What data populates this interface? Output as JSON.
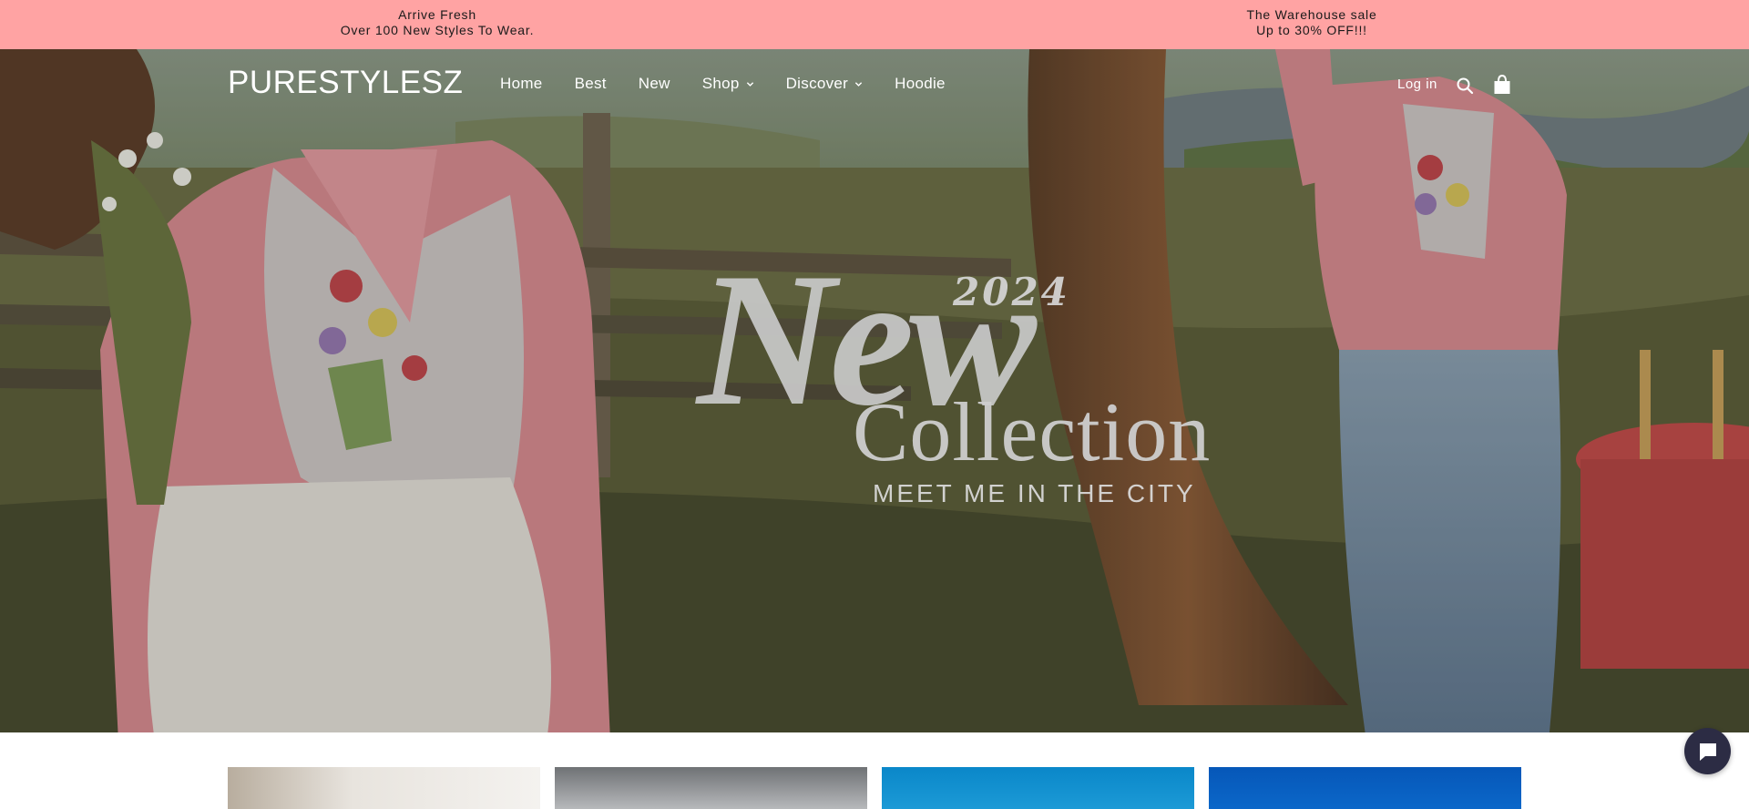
{
  "announcement": {
    "left": {
      "line1": "Arrive Fresh",
      "line2": "Over 100 New Styles To Wear."
    },
    "right": {
      "line1": "The Warehouse sale",
      "line2": "Up to 30% OFF!!!"
    },
    "background": "#ffa3a3"
  },
  "header": {
    "logo": "PURESTYLESZ",
    "nav": [
      {
        "label": "Home",
        "has_dropdown": false
      },
      {
        "label": "Best",
        "has_dropdown": false
      },
      {
        "label": "New",
        "has_dropdown": false
      },
      {
        "label": "Shop",
        "has_dropdown": true
      },
      {
        "label": "Discover",
        "has_dropdown": true
      },
      {
        "label": "Hoodie",
        "has_dropdown": false
      }
    ],
    "login_label": "Log in",
    "icons": [
      "search-icon",
      "cart-icon"
    ]
  },
  "hero": {
    "year": "2024",
    "headline": "New",
    "headline_2": "Collection",
    "subhead": "MEET ME IN THE CITY"
  },
  "colors": {
    "accent_pink": "#e58b98",
    "chat_bg": "#2c2c44"
  }
}
